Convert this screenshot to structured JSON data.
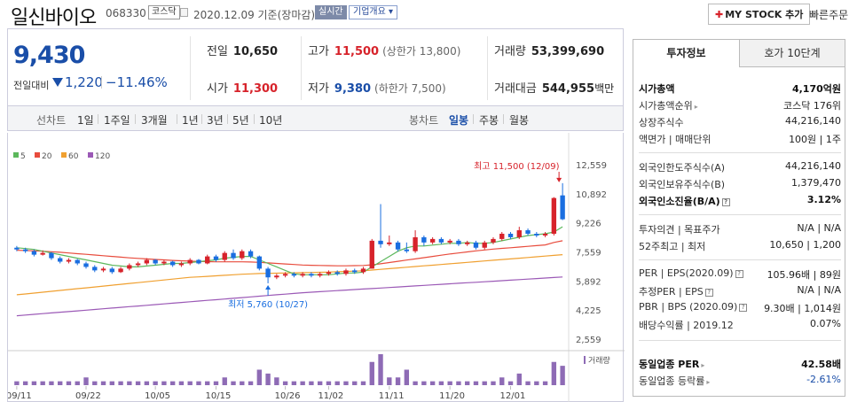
{
  "header": {
    "stock_name": "일신바이오",
    "stock_code": "068330",
    "market_badge": "코스닥",
    "date_text": "2020.12.09  기준(장마감)",
    "realtime_badge": "실시간",
    "corp_overview": "기업개요 ▾",
    "mystock_add": "MY STOCK 추가",
    "quick_order": "빠른주문"
  },
  "quote": {
    "current_price": "9,430",
    "change_label": "전일대비",
    "change_value": "1,220",
    "change_pct": "−11.46%",
    "prev_close_label": "전일",
    "prev_close": "10,650",
    "open_label": "시가",
    "open": "11,300",
    "high_label": "고가",
    "high": "11,500",
    "upper_limit": "(상한가 13,800)",
    "low_label": "저가",
    "low": "9,380",
    "lower_limit": "(하한가 7,500)",
    "volume_label": "거래량",
    "volume": "53,399,690",
    "amount_label": "거래대금",
    "amount": "544,955",
    "amount_unit": "백만"
  },
  "toolbar": {
    "line_label": "선차트",
    "periods": [
      "1일",
      "1주일",
      "3개월",
      "1년",
      "3년",
      "5년",
      "10년"
    ],
    "candle_label": "봉차트",
    "candle_types": [
      "일봉",
      "주봉",
      "월봉"
    ],
    "active_candle": "일봉"
  },
  "chart_data": {
    "type": "candlestick",
    "legend": [
      "5",
      "20",
      "60",
      "120"
    ],
    "ma_colors": {
      "5": "#5cb85c",
      "20": "#e84c3d",
      "60": "#f0a030",
      "120": "#9b59b6"
    },
    "up_color": "#d7232b",
    "down_color": "#1a6ee0",
    "x_tick_labels": [
      "09/11",
      "09/22",
      "10/05",
      "10/15",
      "10/26",
      "11/02",
      "11/11",
      "11/20",
      "12/01"
    ],
    "y_tick_labels": [
      "12,559",
      "10,892",
      "9,226",
      "7,559",
      "5,892",
      "4,225",
      "2,559"
    ],
    "y_ticks": [
      12559,
      10892,
      9226,
      7559,
      5892,
      4225,
      2559
    ],
    "ylim": [
      2559,
      12559
    ],
    "high_annotation": "최고 11,500 (12/09)",
    "low_annotation": "최저 5,760 (10/27)",
    "volume_label": "거래량",
    "candles": [
      [
        7800,
        7700,
        7900,
        7600
      ],
      [
        7700,
        7600,
        7800,
        7500
      ],
      [
        7600,
        7400,
        7700,
        7300
      ],
      [
        7400,
        7500,
        7650,
        7350
      ],
      [
        7500,
        7200,
        7550,
        7100
      ],
      [
        7200,
        7000,
        7300,
        6900
      ],
      [
        7000,
        7100,
        7200,
        6900
      ],
      [
        7100,
        6900,
        7150,
        6800
      ],
      [
        6900,
        6700,
        7000,
        6600
      ],
      [
        6700,
        6500,
        6800,
        6400
      ],
      [
        6500,
        6600,
        6700,
        6400
      ],
      [
        6600,
        6400,
        6700,
        6300
      ],
      [
        6400,
        6600,
        6700,
        6350
      ],
      [
        6600,
        6800,
        6900,
        6500
      ],
      [
        6800,
        6900,
        7000,
        6700
      ],
      [
        6900,
        7100,
        7200,
        6800
      ],
      [
        7100,
        6900,
        7150,
        6800
      ],
      [
        6900,
        7000,
        7100,
        6800
      ],
      [
        7000,
        6800,
        7050,
        6700
      ],
      [
        6800,
        6900,
        7000,
        6700
      ],
      [
        6900,
        7100,
        7200,
        6800
      ],
      [
        7100,
        6900,
        7150,
        6850
      ],
      [
        6900,
        7300,
        7400,
        6850
      ],
      [
        7300,
        7100,
        7400,
        7000
      ],
      [
        7100,
        7500,
        7600,
        7000
      ],
      [
        7500,
        7200,
        7700,
        7100
      ],
      [
        7200,
        7600,
        7700,
        7100
      ],
      [
        7600,
        7300,
        7700,
        7200
      ],
      [
        7300,
        6600,
        7350,
        6500
      ],
      [
        6600,
        6100,
        6700,
        5760
      ],
      [
        6100,
        6200,
        6300,
        6000
      ],
      [
        6200,
        6300,
        6400,
        6100
      ],
      [
        6300,
        6200,
        6400,
        6100
      ],
      [
        6200,
        6300,
        6400,
        6100
      ],
      [
        6300,
        6200,
        6400,
        6100
      ],
      [
        6200,
        6300,
        6400,
        6100
      ],
      [
        6300,
        6400,
        6500,
        6200
      ],
      [
        6400,
        6300,
        6500,
        6200
      ],
      [
        6300,
        6500,
        6600,
        6200
      ],
      [
        6500,
        6400,
        6600,
        6300
      ],
      [
        6400,
        6600,
        6700,
        6300
      ],
      [
        6600,
        8200,
        8300,
        6600
      ],
      [
        8200,
        8000,
        10300,
        7800
      ],
      [
        8000,
        8100,
        8500,
        7900
      ],
      [
        8100,
        7700,
        8200,
        7600
      ],
      [
        7700,
        7600,
        8100,
        7500
      ],
      [
        7600,
        8400,
        8800,
        7500
      ],
      [
        8400,
        8100,
        8500,
        7900
      ],
      [
        8100,
        8300,
        8400,
        8000
      ],
      [
        8300,
        8100,
        8400,
        8000
      ],
      [
        8100,
        8200,
        8300,
        8000
      ],
      [
        8200,
        8000,
        8300,
        7900
      ],
      [
        8000,
        8100,
        8200,
        7900
      ],
      [
        8100,
        7800,
        8200,
        7700
      ],
      [
        7800,
        8100,
        8200,
        7700
      ],
      [
        8100,
        8300,
        8400,
        8000
      ],
      [
        8300,
        8600,
        8700,
        8200
      ],
      [
        8600,
        8400,
        8700,
        8300
      ],
      [
        8400,
        8800,
        9000,
        8300
      ],
      [
        8800,
        8600,
        8900,
        8500
      ],
      [
        8600,
        8500,
        8700,
        8400
      ],
      [
        8500,
        8600,
        8700,
        8400
      ],
      [
        8600,
        10650,
        10700,
        8500
      ],
      [
        10800,
        9430,
        11500,
        9380
      ]
    ],
    "volumes": [
      1,
      1,
      1,
      1,
      1,
      1,
      1,
      1,
      2,
      1,
      1,
      1,
      1,
      1,
      1,
      1,
      1,
      1,
      1,
      1,
      1,
      1,
      1,
      1,
      2,
      1,
      1,
      1,
      4,
      3,
      2,
      1,
      1,
      1,
      1,
      1,
      1,
      1,
      1,
      1,
      1,
      6,
      8,
      2,
      2,
      4,
      1,
      1,
      1,
      1,
      1,
      1,
      1,
      1,
      1,
      1,
      2,
      1,
      3,
      1,
      1,
      1,
      6,
      5
    ],
    "ma5": [
      7800,
      7750,
      7700,
      7600,
      7500,
      7400,
      7300,
      7200,
      7100,
      7000,
      6900,
      6800,
      6750,
      6700,
      6700,
      6750,
      6800,
      6850,
      6900,
      6900,
      6950,
      7000,
      7050,
      7100,
      7200,
      7250,
      7300,
      7300,
      7100,
      6900,
      6700,
      6500,
      6300,
      6250,
      6250,
      6250,
      6250,
      6300,
      6350,
      6350,
      6400,
      6700,
      7000,
      7300,
      7600,
      7800,
      7900,
      7900,
      7950,
      8000,
      8050,
      8050,
      8100,
      8050,
      8050,
      8100,
      8200,
      8300,
      8400,
      8500,
      8550,
      8600,
      8700,
      9000
    ],
    "ma20": [
      7650,
      7640,
      7620,
      7600,
      7570,
      7540,
      7500,
      7460,
      7420,
      7380,
      7340,
      7300,
      7260,
      7220,
      7190,
      7160,
      7130,
      7100,
      7070,
      7050,
      7030,
      7010,
      7000,
      6990,
      6990,
      6990,
      6990,
      6980,
      6960,
      6930,
      6900,
      6870,
      6840,
      6810,
      6790,
      6780,
      6770,
      6760,
      6760,
      6770,
      6780,
      6820,
      6880,
      6950,
      7020,
      7090,
      7160,
      7230,
      7300,
      7370,
      7440,
      7500,
      7560,
      7620,
      7670,
      7720,
      7760,
      7800,
      7840,
      7880,
      7920,
      7960,
      8100,
      8200
    ],
    "ma60": [
      5100,
      5150,
      5200,
      5250,
      5300,
      5350,
      5400,
      5450,
      5500,
      5550,
      5600,
      5650,
      5700,
      5750,
      5800,
      5850,
      5900,
      5950,
      6000,
      6050,
      6100,
      6130,
      6160,
      6190,
      6220,
      6250,
      6280,
      6300,
      6320,
      6330,
      6340,
      6350,
      6360,
      6370,
      6380,
      6390,
      6400,
      6420,
      6440,
      6460,
      6480,
      6520,
      6560,
      6600,
      6640,
      6680,
      6720,
      6760,
      6800,
      6840,
      6880,
      6920,
      6960,
      7000,
      7040,
      7080,
      7120,
      7160,
      7200,
      7240,
      7280,
      7320,
      7360,
      7400
    ],
    "ma120": [
      3900,
      3940,
      3980,
      4020,
      4060,
      4100,
      4140,
      4180,
      4220,
      4260,
      4300,
      4340,
      4380,
      4420,
      4460,
      4500,
      4540,
      4580,
      4620,
      4660,
      4700,
      4740,
      4780,
      4820,
      4860,
      4900,
      4940,
      4980,
      5020,
      5060,
      5100,
      5140,
      5180,
      5220,
      5250,
      5280,
      5310,
      5340,
      5370,
      5400,
      5430,
      5460,
      5490,
      5520,
      5550,
      5580,
      5610,
      5640,
      5670,
      5700,
      5730,
      5760,
      5790,
      5820,
      5850,
      5880,
      5910,
      5940,
      5970,
      6000,
      6030,
      6060,
      6090,
      6120
    ]
  },
  "panel": {
    "tab_active": "투자정보",
    "tab_other": "호가 10단계",
    "rows": [
      {
        "k": "시가총액",
        "v": "4,170억원",
        "bold": true
      },
      {
        "k": "시가총액순위",
        "v": "코스닥 176위"
      },
      {
        "k": "상장주식수",
        "v": "44,216,140"
      },
      {
        "k": "액면가 | 매매단위",
        "v": "100원 | 1주"
      },
      {
        "k": "외국인한도주식수(A)",
        "v": "44,216,140"
      },
      {
        "k": "외국인보유주식수(B)",
        "v": "1,379,470"
      },
      {
        "k": "외국인소진율(B/A)",
        "v": "3.12%",
        "bold": true
      },
      {
        "k": "투자의견 | 목표주가",
        "v": "N/A | N/A"
      },
      {
        "k": "52주최고 | 최저",
        "v": "10,650 | 1,200"
      },
      {
        "k": "PER | EPS(2020.09)",
        "v": "105.96배 | 89원"
      },
      {
        "k": "추정PER | EPS",
        "v": "N/A | N/A"
      },
      {
        "k": "PBR | BPS (2020.09)",
        "v": "9.30배 | 1,014원"
      },
      {
        "k": "배당수익률 | 2019.12",
        "v": "0.07%"
      },
      {
        "k": "동일업종 PER",
        "v": "42.58배",
        "bold": true
      },
      {
        "k": "동일업종 등락률",
        "v": "-2.61%"
      }
    ]
  }
}
